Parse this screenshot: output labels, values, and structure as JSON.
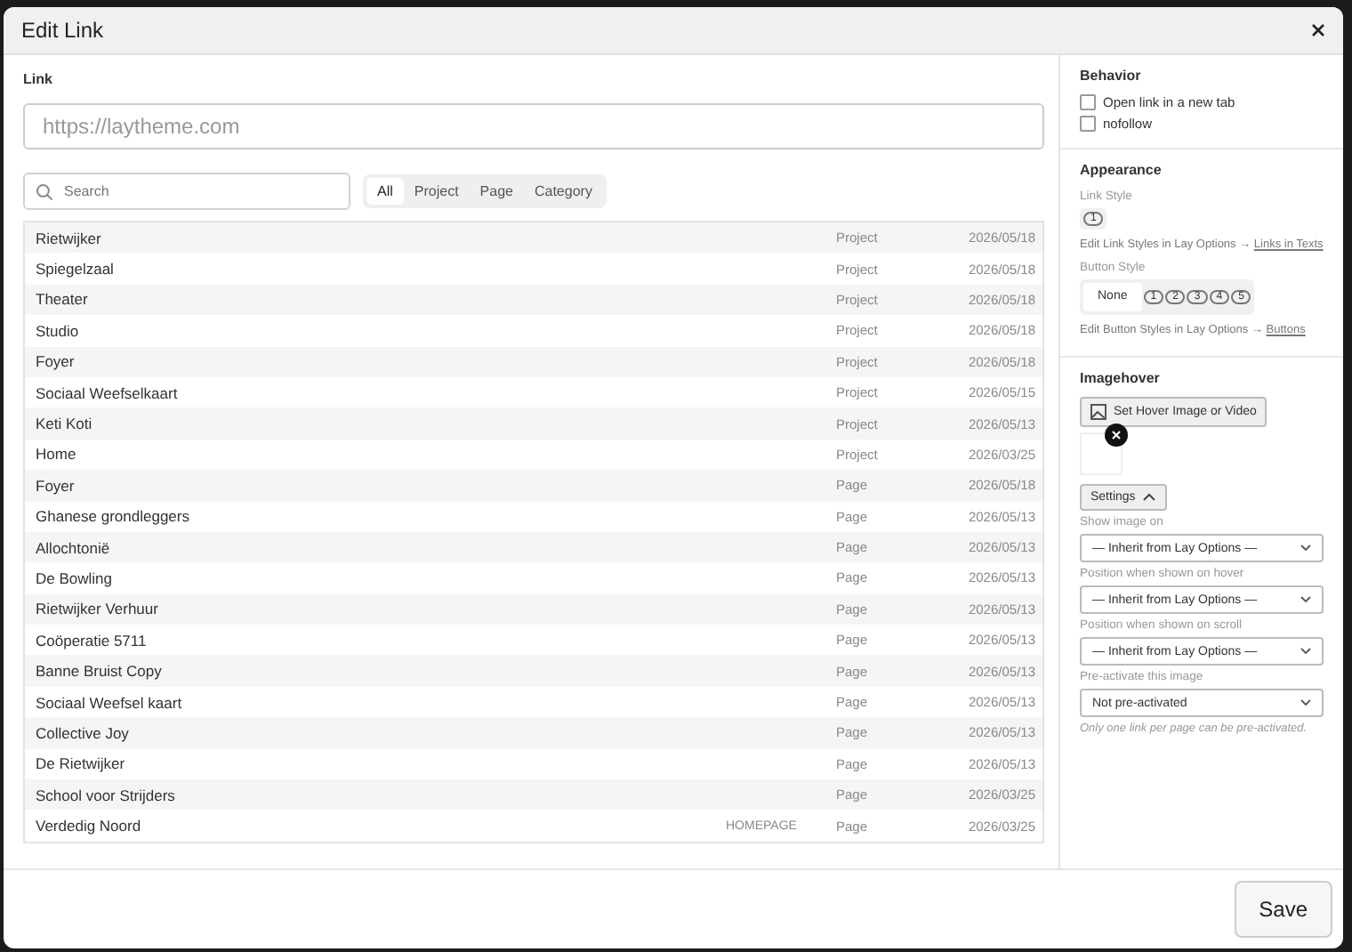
{
  "dialog": {
    "title": "Edit Link"
  },
  "link": {
    "label": "Link",
    "placeholder": "https://laytheme.com"
  },
  "search": {
    "placeholder": "Search"
  },
  "filters": [
    {
      "label": "All",
      "selected": true
    },
    {
      "label": "Project",
      "selected": false
    },
    {
      "label": "Page",
      "selected": false
    },
    {
      "label": "Category",
      "selected": false
    }
  ],
  "rows": [
    {
      "name": "Rietwijker",
      "type": "Project",
      "date": "2026/05/18"
    },
    {
      "name": "Spiegelzaal",
      "type": "Project",
      "date": "2026/05/18"
    },
    {
      "name": "Theater",
      "type": "Project",
      "date": "2026/05/18"
    },
    {
      "name": "Studio",
      "type": "Project",
      "date": "2026/05/18"
    },
    {
      "name": "Foyer",
      "type": "Project",
      "date": "2026/05/18"
    },
    {
      "name": "Sociaal Weefselkaart",
      "type": "Project",
      "date": "2026/05/15"
    },
    {
      "name": "Keti Koti",
      "type": "Project",
      "date": "2026/05/13"
    },
    {
      "name": "Home",
      "type": "Project",
      "date": "2026/03/25"
    },
    {
      "name": "Foyer",
      "type": "Page",
      "date": "2026/05/18"
    },
    {
      "name": "Ghanese grondleggers",
      "type": "Page",
      "date": "2026/05/13"
    },
    {
      "name": "Allochtonië",
      "type": "Page",
      "date": "2026/05/13"
    },
    {
      "name": "De Bowling",
      "type": "Page",
      "date": "2026/05/13"
    },
    {
      "name": "Rietwijker Verhuur",
      "type": "Page",
      "date": "2026/05/13"
    },
    {
      "name": "Coöperatie 5711",
      "type": "Page",
      "date": "2026/05/13"
    },
    {
      "name": "Banne Bruist Copy",
      "type": "Page",
      "date": "2026/05/13"
    },
    {
      "name": "Sociaal Weefsel kaart",
      "type": "Page",
      "date": "2026/05/13"
    },
    {
      "name": "Collective Joy",
      "type": "Page",
      "date": "2026/05/13"
    },
    {
      "name": "De Rietwijker",
      "type": "Page",
      "date": "2026/05/13"
    },
    {
      "name": "School voor Strijders",
      "type": "Page",
      "date": "2026/03/25"
    },
    {
      "name": "Verdedig Noord",
      "tag": "HOMEPAGE",
      "type": "Page",
      "date": "2026/03/25"
    }
  ],
  "behavior": {
    "title": "Behavior",
    "options": [
      {
        "label": "Open link in a new tab",
        "checked": false
      },
      {
        "label": "nofollow",
        "checked": false
      }
    ]
  },
  "appearance": {
    "title": "Appearance",
    "link_style": {
      "label": "Link Style",
      "options": [
        {
          "label": "1",
          "selected": false
        }
      ],
      "hint": "Edit Link Styles in Lay Options →",
      "hint_link": "Links in Texts"
    },
    "button_style": {
      "label": "Button Style",
      "options": [
        {
          "label": "None",
          "selected": true
        },
        {
          "label": "1",
          "selected": false
        },
        {
          "label": "2",
          "selected": false
        },
        {
          "label": "3",
          "selected": false
        },
        {
          "label": "4",
          "selected": false
        },
        {
          "label": "5",
          "selected": false
        }
      ],
      "hint": "Edit Button Styles in Lay Options →",
      "hint_link": "Buttons"
    }
  },
  "imagehover": {
    "title": "Imagehover",
    "set_button": "Set Hover Image or Video",
    "settings_button": "Settings",
    "settings_expanded": true,
    "fields": [
      {
        "label": "Show image on",
        "value": "— Inherit from Lay Options —"
      },
      {
        "label": "Position when shown on hover",
        "value": "— Inherit from Lay Options —"
      },
      {
        "label": "Position when shown on scroll",
        "value": "— Inherit from Lay Options —"
      },
      {
        "label": "Pre-activate this image",
        "value": "Not pre-activated"
      }
    ],
    "note": "Only one link per page can be pre-activated."
  },
  "footer": {
    "save": "Save"
  }
}
